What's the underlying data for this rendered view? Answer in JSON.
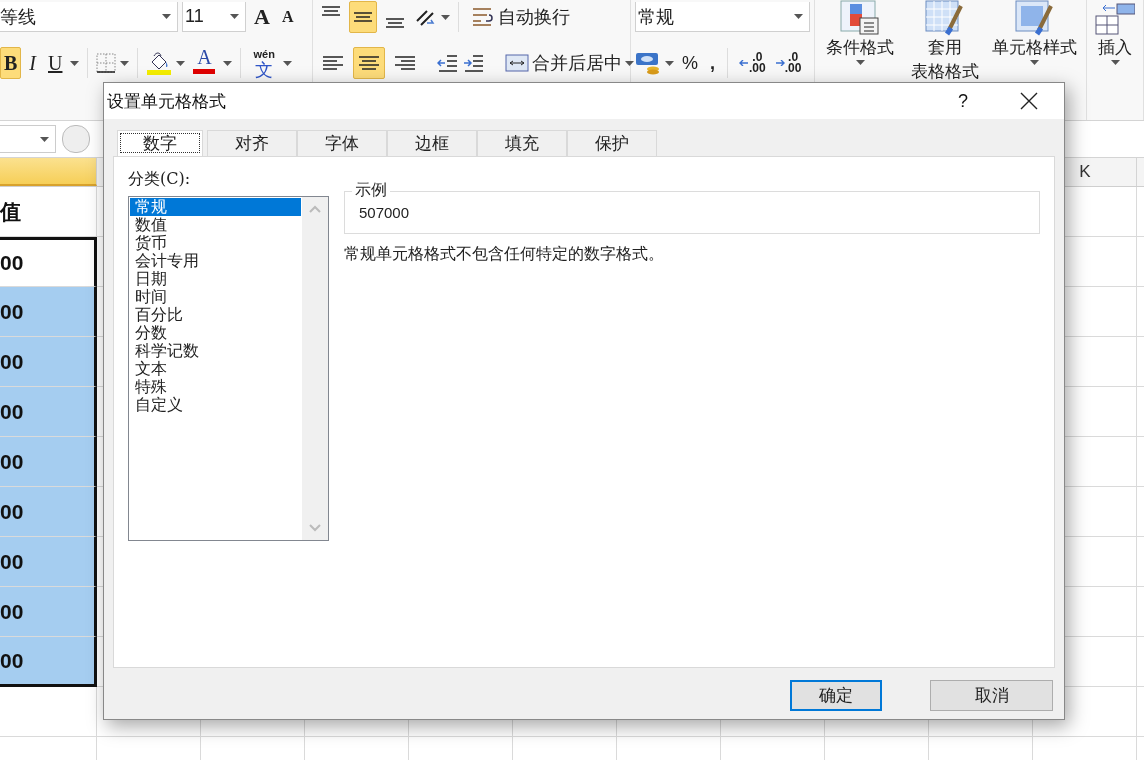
{
  "ribbon": {
    "font_name": "等线",
    "font_size": "11",
    "grow_font_glyph": "A",
    "shrink_font_glyph": "A",
    "bold": {
      "label": "B",
      "selected": true
    },
    "italic": {
      "label": "I",
      "selected": false
    },
    "underline": {
      "label": "U",
      "selected": false
    },
    "font_color_glyph": "A",
    "phonetic": {
      "top": "wén",
      "bottom": "文"
    },
    "vertical_align": [
      {
        "selected": false
      },
      {
        "selected": true
      },
      {
        "selected": false
      }
    ],
    "horizontal_align": [
      {
        "selected": false
      },
      {
        "selected": true
      },
      {
        "selected": false
      }
    ],
    "wrap_text": "自动换行",
    "merge_center": "合并后居中",
    "number_format": "常规",
    "percent": "%",
    "comma": ",",
    "increase_decimal": {
      "top": ".0",
      "bottom": ".00"
    },
    "decrease_decimal": {
      "top": ".0",
      "bottom": ".00"
    },
    "styles": [
      {
        "lines": [
          "条件格式"
        ]
      },
      {
        "lines": [
          "套用",
          "表格格式"
        ]
      },
      {
        "lines": [
          "单元格样式"
        ]
      }
    ],
    "insert": "插入"
  },
  "sheet": {
    "column_headers": [
      {
        "selected": true
      },
      {
        "label": "K",
        "selected": false
      }
    ],
    "column_a": [
      {
        "value": "值",
        "active": false,
        "selected": false
      },
      {
        "value": "00",
        "active": true,
        "selected": false
      },
      {
        "value": "00",
        "active": false,
        "selected": true
      },
      {
        "value": "00",
        "active": false,
        "selected": true
      },
      {
        "value": "00",
        "active": false,
        "selected": true
      },
      {
        "value": "00",
        "active": false,
        "selected": true
      },
      {
        "value": "00",
        "active": false,
        "selected": true
      },
      {
        "value": "00",
        "active": false,
        "selected": true
      },
      {
        "value": "00",
        "active": false,
        "selected": true
      },
      {
        "value": "00",
        "active": false,
        "selected": true
      }
    ]
  },
  "dialog": {
    "title": "设置单元格格式",
    "help": "?",
    "tabs": [
      {
        "label": "数字",
        "selected": true
      },
      {
        "label": "对齐",
        "selected": false
      },
      {
        "label": "字体",
        "selected": false
      },
      {
        "label": "边框",
        "selected": false
      },
      {
        "label": "填充",
        "selected": false
      },
      {
        "label": "保护",
        "selected": false
      }
    ],
    "category_label": "分类(C):",
    "categories": [
      {
        "label": "常规",
        "selected": true
      },
      {
        "label": "数值",
        "selected": false
      },
      {
        "label": "货币",
        "selected": false
      },
      {
        "label": "会计专用",
        "selected": false
      },
      {
        "label": "日期",
        "selected": false
      },
      {
        "label": "时间",
        "selected": false
      },
      {
        "label": "百分比",
        "selected": false
      },
      {
        "label": "分数",
        "selected": false
      },
      {
        "label": "科学记数",
        "selected": false
      },
      {
        "label": "文本",
        "selected": false
      },
      {
        "label": "特殊",
        "selected": false
      },
      {
        "label": "自定义",
        "selected": false
      }
    ],
    "sample_label": "示例",
    "sample_value": "507000",
    "description": "常规单元格格式不包含任何特定的数字格式。",
    "buttons": [
      {
        "label": "确定",
        "default": true
      },
      {
        "label": "取消",
        "default": false
      }
    ]
  }
}
